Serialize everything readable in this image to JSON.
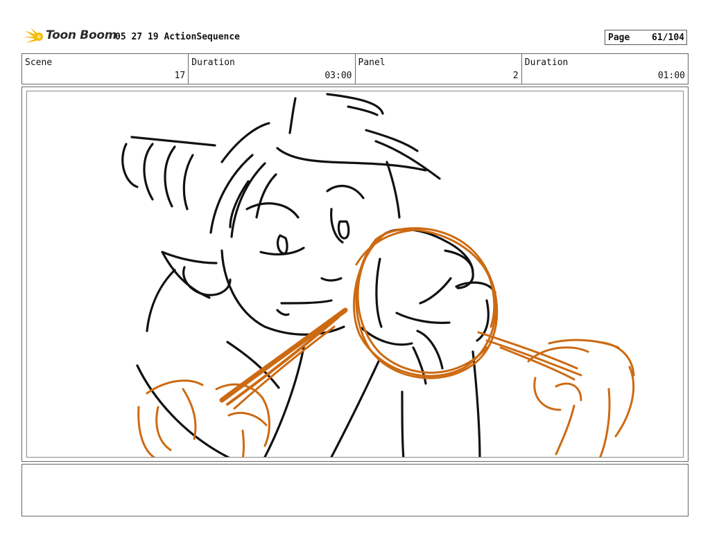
{
  "header": {
    "brand": "Toon Boom",
    "document_title": "05 27 19 ActionSequence",
    "page_label": "Page",
    "page_number": "61/104",
    "logo_icon": "starburst-icon"
  },
  "info": {
    "scene_label": "Scene",
    "scene_value": "17",
    "scene_duration_label": "Duration",
    "scene_duration_value": "03:00",
    "panel_label": "Panel",
    "panel_value": "2",
    "panel_duration_label": "Duration",
    "panel_duration_value": "01:00"
  },
  "colors": {
    "sketch_line": "#111111",
    "motion_line": "#cc6a12",
    "logo_accent": "#f5b800"
  },
  "notes": {
    "text": ""
  }
}
